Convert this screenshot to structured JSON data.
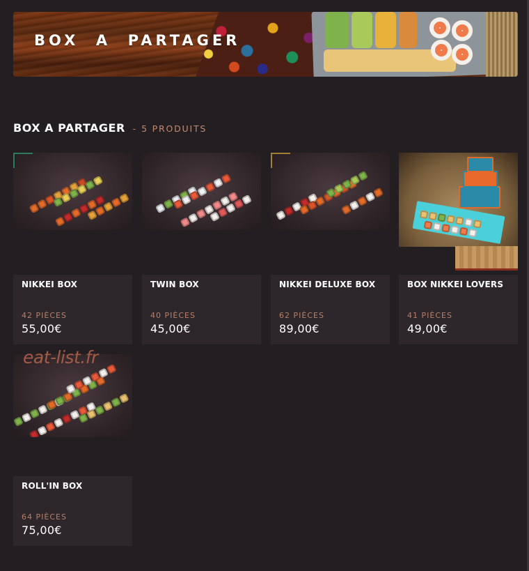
{
  "banner": {
    "title": "BOX  A  PARTAGER"
  },
  "section": {
    "title": "BOX A PARTAGER",
    "separator": "-",
    "count": "5 PRODUITS"
  },
  "products": [
    {
      "name": "NIKKEI BOX",
      "pieces": "42 PIÈCES",
      "price": "55,00€"
    },
    {
      "name": "TWIN BOX",
      "pieces": "40 PIÈCES",
      "price": "45,00€"
    },
    {
      "name": "NIKKEI DELUXE BOX",
      "pieces": "62 PIÈCES",
      "price": "89,00€"
    },
    {
      "name": "BOX NIKKEI LOVERS",
      "pieces": "41 PIÈCES",
      "price": "49,00€"
    },
    {
      "name": "ROLL'IN BOX",
      "pieces": "64 PIÈCES",
      "price": "75,00€"
    }
  ],
  "watermark": "eat-list.fr",
  "colors": {
    "background": "#231e22",
    "card": "#2d272c",
    "accent": "#c48b6f"
  }
}
